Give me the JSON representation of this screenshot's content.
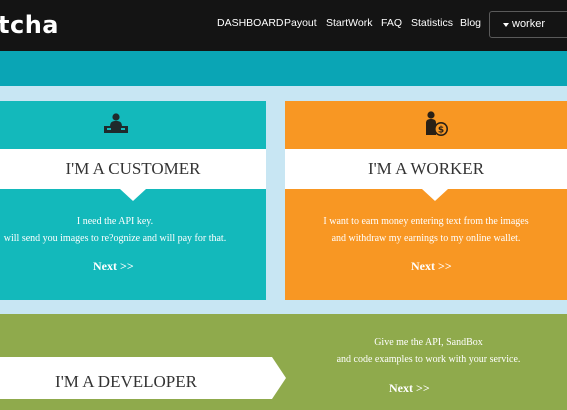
{
  "header": {
    "logo": "tcha",
    "nav": [
      "DASHBOARD",
      "Payout",
      "StartWork",
      "FAQ",
      "Statistics",
      "Blog"
    ],
    "user_menu": "worker"
  },
  "customer": {
    "title": "I'M A CUSTOMER",
    "desc_line1": "I need the API key.",
    "desc_line2": "will send you images to re?ognize and will pay for that.",
    "next": "Next >>",
    "icon": "desk-person-icon"
  },
  "worker": {
    "title": "I'M A WORKER",
    "desc_line1": "I want to earn money entering text from the images",
    "desc_line2": "and withdraw my earnings to my online wallet.",
    "next": "Next >>",
    "icon": "person-coin-icon"
  },
  "developer": {
    "title": "I'M A DEVELOPER",
    "desc_line1": "Give me the API, SandBox",
    "desc_line2": "and code examples to work with your service.",
    "next": "Next >>",
    "icon": "code-icon"
  },
  "colors": {
    "topbar": "#141414",
    "teal_band": "#0aa5b5",
    "customer": "#13b9bb",
    "worker": "#f89723",
    "developer": "#8faa4c",
    "background": "#c8e6f3"
  }
}
